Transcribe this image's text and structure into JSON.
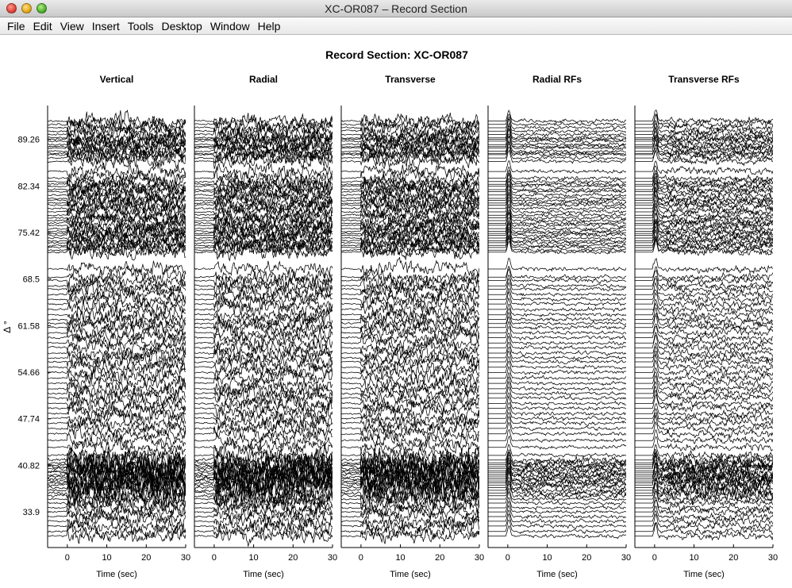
{
  "window": {
    "title": "XC-OR087 – Record Section"
  },
  "menu": [
    "File",
    "Edit",
    "View",
    "Insert",
    "Tools",
    "Desktop",
    "Window",
    "Help"
  ],
  "chart_data": {
    "type": "line",
    "title": "Record Section: XC-OR087",
    "ylabel": "Δ °",
    "ylim": [
      28.6,
      94.3
    ],
    "yticks": [
      "89.26",
      "82.34",
      "75.42",
      "68.5",
      "61.58",
      "54.66",
      "47.74",
      "40.82",
      "33.9"
    ],
    "panels": [
      {
        "name": "Vertical",
        "xlabel": "Time (sec)",
        "xlim": [
          -5,
          30
        ],
        "xticks": [
          "0",
          "10",
          "20",
          "30"
        ],
        "amplitude": 1.0
      },
      {
        "name": "Radial",
        "xlabel": "Time (sec)",
        "xlim": [
          -5,
          30
        ],
        "xticks": [
          "0",
          "10",
          "20",
          "30"
        ],
        "amplitude": 1.0
      },
      {
        "name": "Transverse",
        "xlabel": "Time (sec)",
        "xlim": [
          -5,
          30
        ],
        "xticks": [
          "0",
          "10",
          "20",
          "30"
        ],
        "amplitude": 0.95
      },
      {
        "name": "Radial RFs",
        "xlabel": "Time (sec)",
        "xlim": [
          -5,
          30
        ],
        "xticks": [
          "0",
          "10",
          "20",
          "30"
        ],
        "amplitude": 0.45
      },
      {
        "name": "Transverse RFs",
        "xlabel": "Time (sec)",
        "xlim": [
          -5,
          30
        ],
        "xticks": [
          "0",
          "10",
          "20",
          "30"
        ],
        "amplitude": 0.9
      }
    ],
    "trace_distances": [
      92.0,
      91.5,
      91.0,
      90.5,
      90.0,
      89.5,
      89.3,
      89.0,
      88.5,
      88.2,
      88.0,
      87.5,
      87.2,
      87.0,
      86.5,
      86.0,
      84.5,
      83.5,
      83.0,
      82.6,
      82.3,
      81.8,
      81.5,
      81.0,
      80.5,
      80.2,
      79.8,
      79.5,
      79.0,
      78.5,
      78.0,
      77.6,
      77.2,
      76.8,
      76.5,
      76.0,
      75.6,
      75.3,
      75.0,
      74.6,
      74.2,
      73.9,
      73.5,
      73.2,
      72.8,
      72.5,
      70.0,
      68.8,
      68.3,
      67.5,
      67.0,
      66.2,
      65.5,
      64.8,
      64.0,
      63.2,
      62.5,
      61.9,
      61.3,
      60.5,
      59.8,
      59.0,
      58.3,
      57.5,
      56.8,
      56.2,
      55.4,
      54.6,
      53.8,
      53.0,
      52.2,
      51.5,
      50.8,
      50.0,
      49.3,
      48.5,
      47.8,
      47.1,
      46.3,
      45.5,
      44.5,
      43.5,
      42.3,
      41.6,
      41.2,
      40.9,
      40.6,
      40.3,
      40.0,
      39.7,
      39.4,
      39.1,
      38.8,
      38.5,
      38.2,
      37.9,
      37.5,
      37.1,
      36.7,
      36.3,
      35.8,
      35.2,
      34.5,
      33.9,
      33.2,
      32.5,
      31.8,
      31.0,
      30.3
    ]
  }
}
